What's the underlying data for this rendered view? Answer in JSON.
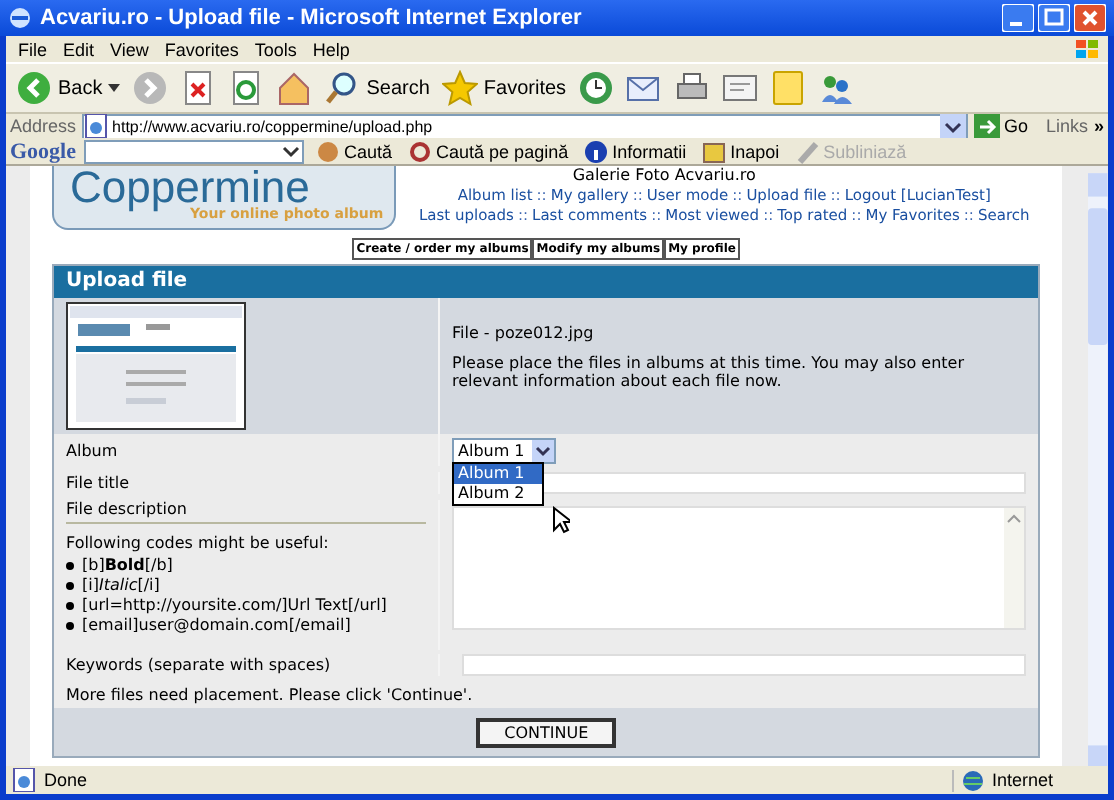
{
  "window": {
    "title": "Acvariu.ro - Upload file - Microsoft Internet Explorer"
  },
  "menu": [
    "File",
    "Edit",
    "View",
    "Favorites",
    "Tools",
    "Help"
  ],
  "toolbar": [
    {
      "kind": "back",
      "label": "Back"
    },
    {
      "kind": "forward"
    },
    {
      "kind": "stop"
    },
    {
      "kind": "refresh"
    },
    {
      "kind": "home"
    },
    {
      "kind": "search",
      "label": "Search"
    },
    {
      "kind": "favorites",
      "label": "Favorites"
    },
    {
      "kind": "history"
    },
    {
      "kind": "mail"
    },
    {
      "kind": "print"
    },
    {
      "kind": "edit"
    },
    {
      "kind": "note"
    },
    {
      "kind": "messenger"
    }
  ],
  "address": {
    "label": "Address",
    "url": "http://www.acvariu.ro/coppermine/upload.php",
    "go": "Go",
    "links": "Links",
    "more": "»"
  },
  "google_bar": {
    "logo": "Google",
    "items": [
      {
        "kind": "search",
        "label": "Caută",
        "disabled": false
      },
      {
        "kind": "find",
        "label": "Caută pe pagină",
        "disabled": false
      },
      {
        "kind": "info",
        "label": "Informatii",
        "disabled": false
      },
      {
        "kind": "back",
        "label": "Inapoi",
        "disabled": false
      },
      {
        "kind": "highlight",
        "label": "Subliniază",
        "disabled": true
      }
    ]
  },
  "page": {
    "logo": {
      "title": "Coppermine",
      "tagline": "Your online photo album"
    },
    "site_title": "Galerie Foto Acvariu.ro",
    "nav": [
      [
        {
          "kind": "link",
          "label": "Album list"
        },
        {
          "kind": "separator",
          "label": "::"
        },
        {
          "kind": "link",
          "label": "My gallery"
        },
        {
          "kind": "separator",
          "label": "::"
        },
        {
          "kind": "link",
          "label": "User mode"
        },
        {
          "kind": "separator",
          "label": "::"
        },
        {
          "kind": "link",
          "label": "Upload file"
        },
        {
          "kind": "separator",
          "label": "::"
        },
        {
          "kind": "link",
          "label": "Logout [LucianTest]"
        }
      ],
      [
        {
          "kind": "link",
          "label": "Last uploads"
        },
        {
          "kind": "separator",
          "label": "::"
        },
        {
          "kind": "link",
          "label": "Last comments"
        },
        {
          "kind": "separator",
          "label": "::"
        },
        {
          "kind": "link",
          "label": "Most viewed"
        },
        {
          "kind": "separator",
          "label": "::"
        },
        {
          "kind": "link",
          "label": "Top rated"
        },
        {
          "kind": "separator",
          "label": "::"
        },
        {
          "kind": "link",
          "label": "My Favorites"
        },
        {
          "kind": "separator",
          "label": "::"
        },
        {
          "kind": "link",
          "label": "Search"
        }
      ]
    ],
    "user_buttons": [
      "Create / order my albums",
      "Modify my albums",
      "My profile"
    ],
    "panel": {
      "title": "Upload file",
      "file_label": "File - poze012.jpg",
      "instructions": "Please place the files in albums at this time. You may also enter relevant information about each file now.",
      "album": {
        "label": "Album",
        "value": "Album 1",
        "expanded": true,
        "options": [
          {
            "label": "Album 1",
            "selected": true
          },
          {
            "label": "Album 2",
            "selected": false
          }
        ]
      },
      "file_title_label": "File title",
      "description_label": "File description",
      "codes_intro": "Following codes might be useful:",
      "codes": [
        "[b]**Bold**[/b]",
        "[i]*Italic*[/i]",
        "[url=http://yoursite.com/]Url Text[/url]",
        "[email]user@domain.com[/email]"
      ],
      "keywords_label": "Keywords (separate with spaces)",
      "notice": "More files need placement. Please click 'Continue'.",
      "continue": "CONTINUE"
    }
  },
  "status_bar": {
    "text": "Done",
    "zone": "Internet"
  }
}
